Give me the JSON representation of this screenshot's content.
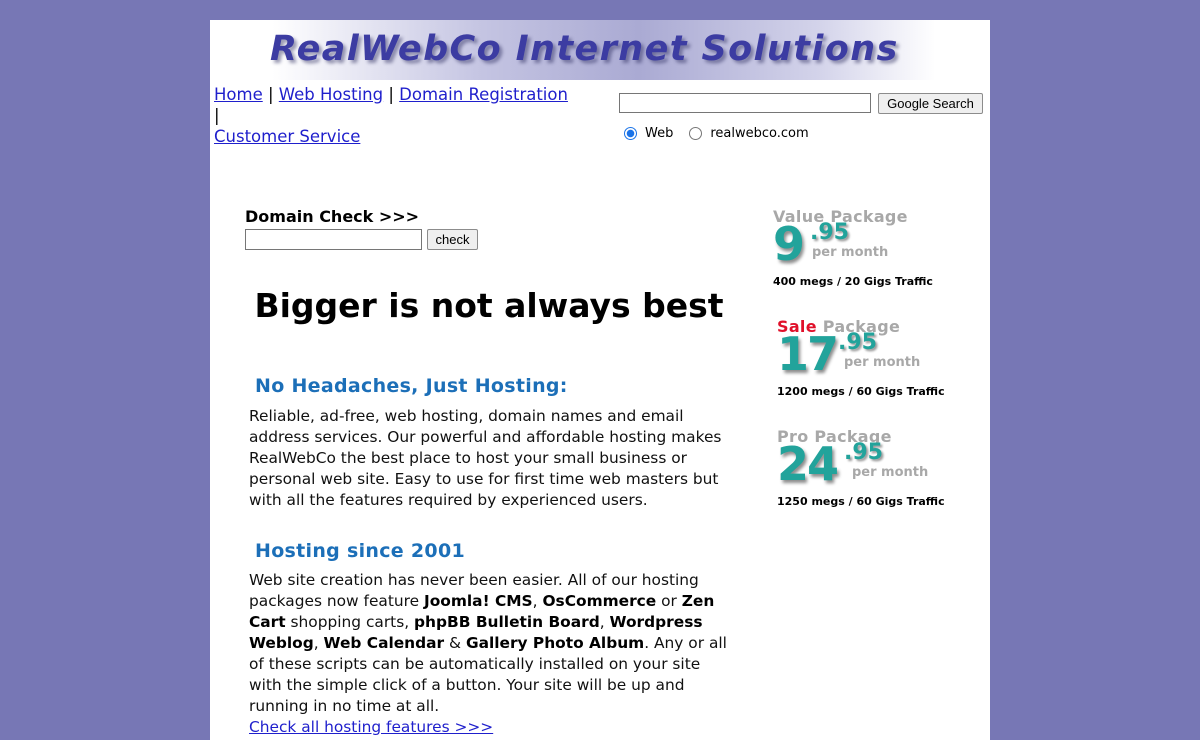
{
  "banner": {
    "title": "RealWebCo Internet Solutions"
  },
  "nav": {
    "items": [
      {
        "label": "Home"
      },
      {
        "label": "Web Hosting"
      },
      {
        "label": "Domain Registration"
      },
      {
        "label": "Customer Service"
      }
    ],
    "separator": "|"
  },
  "search": {
    "value": "",
    "button_label": "Google Search",
    "options": [
      {
        "label": "Web",
        "selected": true
      },
      {
        "label": "realwebco.com",
        "selected": false
      }
    ]
  },
  "domain_check": {
    "label": "Domain Check >>>",
    "value": "",
    "button_label": "check"
  },
  "main": {
    "headline": "Bigger is not always best",
    "sections": [
      {
        "title": "No Headaches, Just Hosting:",
        "text": "Reliable, ad-free, web hosting, domain names and email address services. Our powerful and affordable hosting makes RealWebCo the best place to host your small business or personal web site. Easy to use for first time web masters but with all the features required by experienced users."
      },
      {
        "title": "Hosting since 2001",
        "parts": {
          "t1": "Web site creation has never been easier. All of our hosting packages now feature ",
          "b1": "Joomla! CMS",
          "t2": ", ",
          "b2": "OsCommerce",
          "t3": " or ",
          "b3": "Zen Cart",
          "t4": " shopping carts, ",
          "b4": "phpBB Bulletin Board",
          "t5": ", ",
          "b5": "Wordpress Weblog",
          "t6": ", ",
          "b6": "Web Calendar",
          "t7": " & ",
          "b7": "Gallery Photo Album",
          "t8": ". Any or all of these scripts can be automatically installed on your site with the simple click of a button. Your site will be up and running in no time at all."
        },
        "link": "Check all hosting features >>>"
      }
    ]
  },
  "packages": [
    {
      "name_prefix": "",
      "name": "Value Package",
      "price_int": "9",
      "price_dec": ".95",
      "per": "per month",
      "traffic": "400 megs / 20 Gigs Traffic"
    },
    {
      "name_prefix": "Sale",
      "name": "Package",
      "price_int": "17",
      "price_dec": ".95",
      "per": "per month",
      "traffic": "1200 megs / 60 Gigs Traffic"
    },
    {
      "name_prefix": "",
      "name": "Pro Package",
      "price_int": "24",
      "price_dec": ".95",
      "per": "per month",
      "traffic": "1250 megs / 60 Gigs Traffic"
    }
  ]
}
